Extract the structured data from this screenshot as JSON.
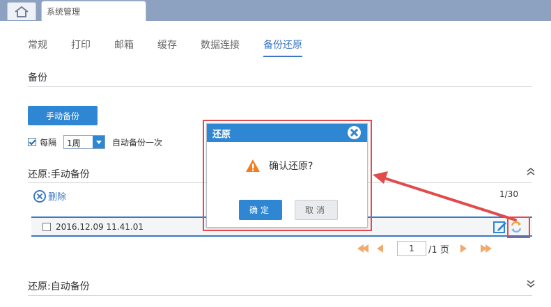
{
  "tab_bar": {
    "home_icon": "home-icon",
    "page_tab_label": "系统管理"
  },
  "nav": {
    "tabs": [
      {
        "label": "常规",
        "active": false
      },
      {
        "label": "打印",
        "active": false
      },
      {
        "label": "邮箱",
        "active": false
      },
      {
        "label": "缓存",
        "active": false
      },
      {
        "label": "数据连接",
        "active": false
      },
      {
        "label": "备份还原",
        "active": true
      }
    ]
  },
  "backup": {
    "title": "备份",
    "manual_button": "手动备份",
    "auto": {
      "checked": true,
      "prefix": "每隔",
      "interval": "1周",
      "suffix": "自动备份一次"
    }
  },
  "manual_restore": {
    "title": "还原:手动备份",
    "collapse_icon": "double-chevron-up-icon",
    "delete_label": "删除",
    "count": "1/30",
    "rows": [
      {
        "checked": false,
        "name": "2016.12.09 11.41.01"
      }
    ],
    "pager": {
      "current": "1",
      "total": "/1 页"
    }
  },
  "auto_restore": {
    "title": "还原:自动备份",
    "expand_icon": "double-chevron-down-icon"
  },
  "dialog": {
    "title": "还原",
    "message": "确认还原?",
    "ok_label": "确定",
    "cancel_label": "取消"
  },
  "colors": {
    "accent": "#2f86d3",
    "highlight": "#e24b4b",
    "pager_arrow": "#f2a96b",
    "tabbar": "#8da2c1"
  }
}
